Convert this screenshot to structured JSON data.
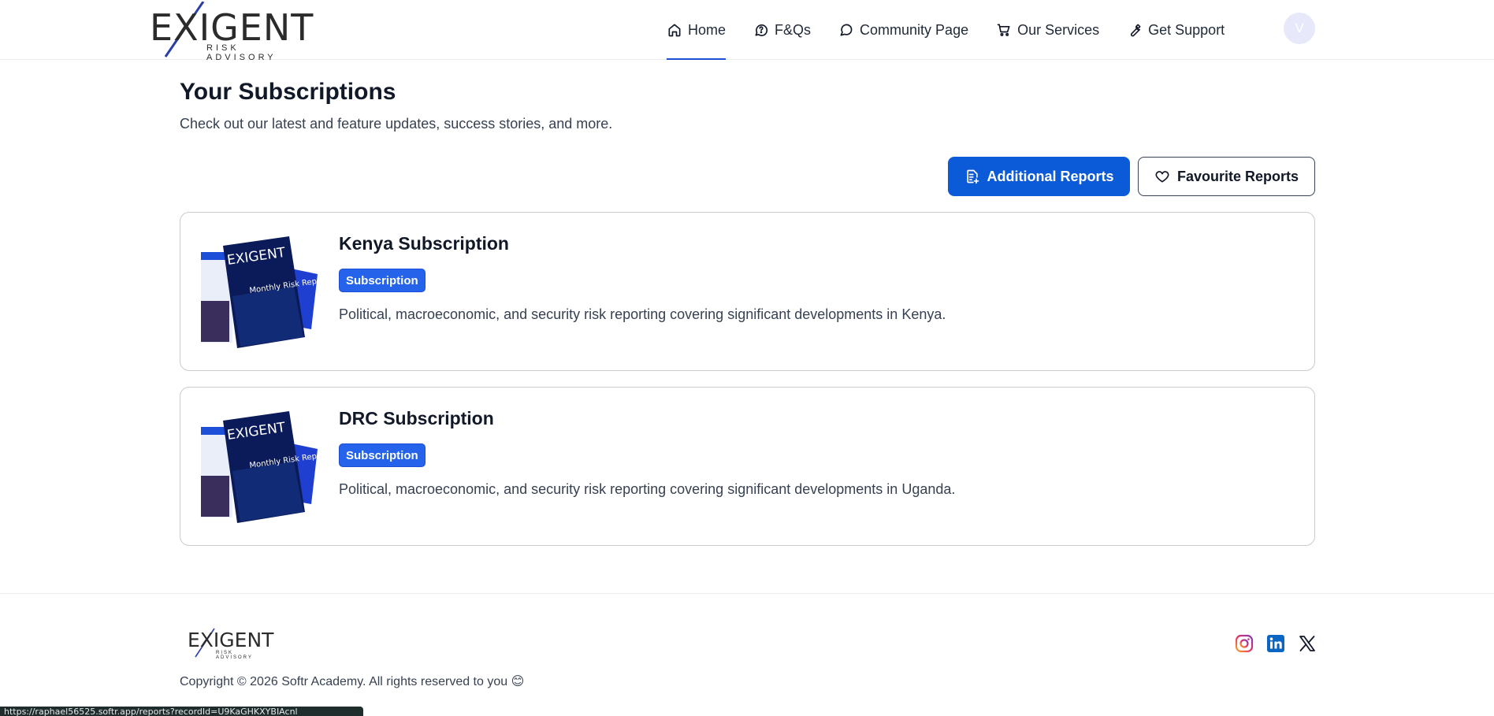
{
  "brand": {
    "logo_word": "EXIGENT",
    "logo_sub": "RISK ADVISORY"
  },
  "nav": {
    "items": [
      {
        "label": "Home",
        "icon": "home-icon",
        "active": true
      },
      {
        "label": "F&Qs",
        "icon": "chat-question-icon",
        "active": false
      },
      {
        "label": "Community Page",
        "icon": "chat-bubble-icon",
        "active": false
      },
      {
        "label": "Our Services",
        "icon": "cart-icon",
        "active": false
      },
      {
        "label": "Get Support",
        "icon": "wrench-icon",
        "active": false
      }
    ],
    "avatar_initial": "V"
  },
  "main": {
    "title": "Your Subscriptions",
    "subtitle": "Check out our latest and feature updates, success stories, and more.",
    "additional_reports_label": "Additional Reports",
    "favourite_reports_label": "Favourite Reports",
    "cards": [
      {
        "title": "Kenya Subscription",
        "badge": "Subscription",
        "description": "Political, macroeconomic, and security risk reporting covering significant developments in Kenya.",
        "thumb_title": "Monthly Risk Report"
      },
      {
        "title": "DRC Subscription",
        "badge": "Subscription",
        "description": "Political, macroeconomic, and security risk reporting covering significant developments in Uganda.",
        "thumb_title": "Monthly Risk Report"
      }
    ]
  },
  "footer": {
    "copyright": "Copyright © 2026 Softr Academy. All rights reserved to you 😊",
    "social": [
      "instagram-icon",
      "linkedin-icon",
      "x-icon"
    ]
  },
  "status_url": "https://raphael56525.softr.app/reports?recordId=U9KaGHKXYBIAcnl"
}
